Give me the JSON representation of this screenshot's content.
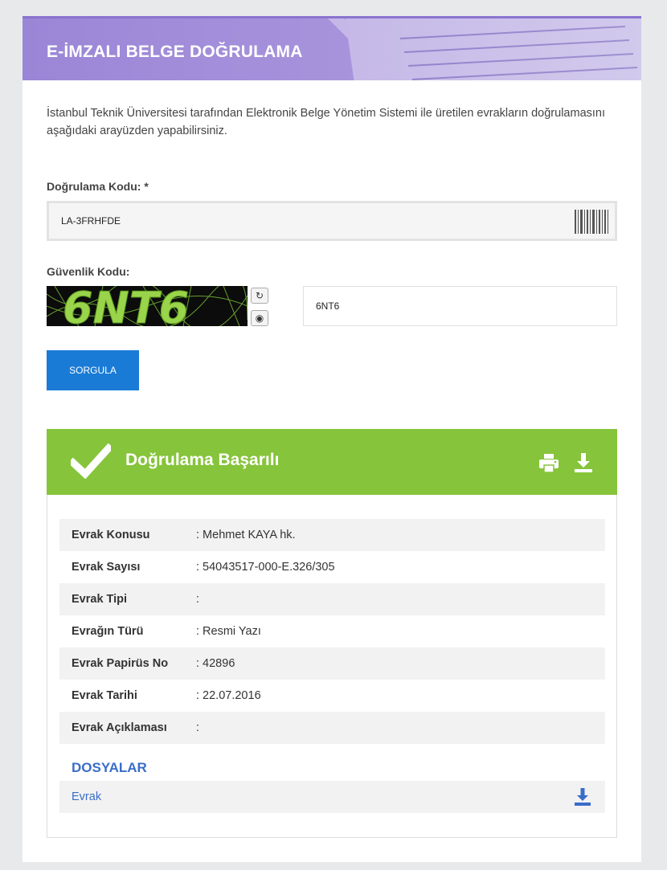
{
  "header": {
    "title": "E-İMZALI BELGE DOĞRULAMA"
  },
  "intro": {
    "text": "İstanbul Teknik Üniversitesi tarafından Elektronik Belge Yönetim Sistemi ile üretilen evrakların doğrulamasını aşağıdaki arayüzden yapabilirsiniz."
  },
  "form": {
    "code_label": "Doğrulama Kodu: *",
    "code_value": "LA-3FRHFDE",
    "security_label": "Güvenlik Kodu:",
    "captcha_text": "6NT6",
    "security_value": "6NT6",
    "submit_label": "SORGULA",
    "refresh_icon": "refresh-icon",
    "audio_icon": "audio-icon"
  },
  "result": {
    "title": "Doğrulama Başarılı",
    "status_color": "#86c43b",
    "fields": [
      {
        "key": "Evrak Konusu",
        "value": ": Mehmet KAYA hk."
      },
      {
        "key": "Evrak Sayısı",
        "value": ": 54043517-000-E.326/305"
      },
      {
        "key": "Evrak Tipi",
        "value": ":"
      },
      {
        "key": "Evrağın Türü",
        "value": ": Resmi Yazı"
      },
      {
        "key": "Evrak Papirüs No",
        "value": ": 42896"
      },
      {
        "key": "Evrak Tarihi",
        "value": ": 22.07.2016"
      },
      {
        "key": "Evrak Açıklaması",
        "value": ":"
      }
    ],
    "files_title": "DOSYALAR",
    "files": [
      {
        "name": "Evrak"
      }
    ]
  },
  "colors": {
    "accent": "#1a7bd6",
    "banner": "#9a86d6",
    "link": "#3a6dc9"
  }
}
